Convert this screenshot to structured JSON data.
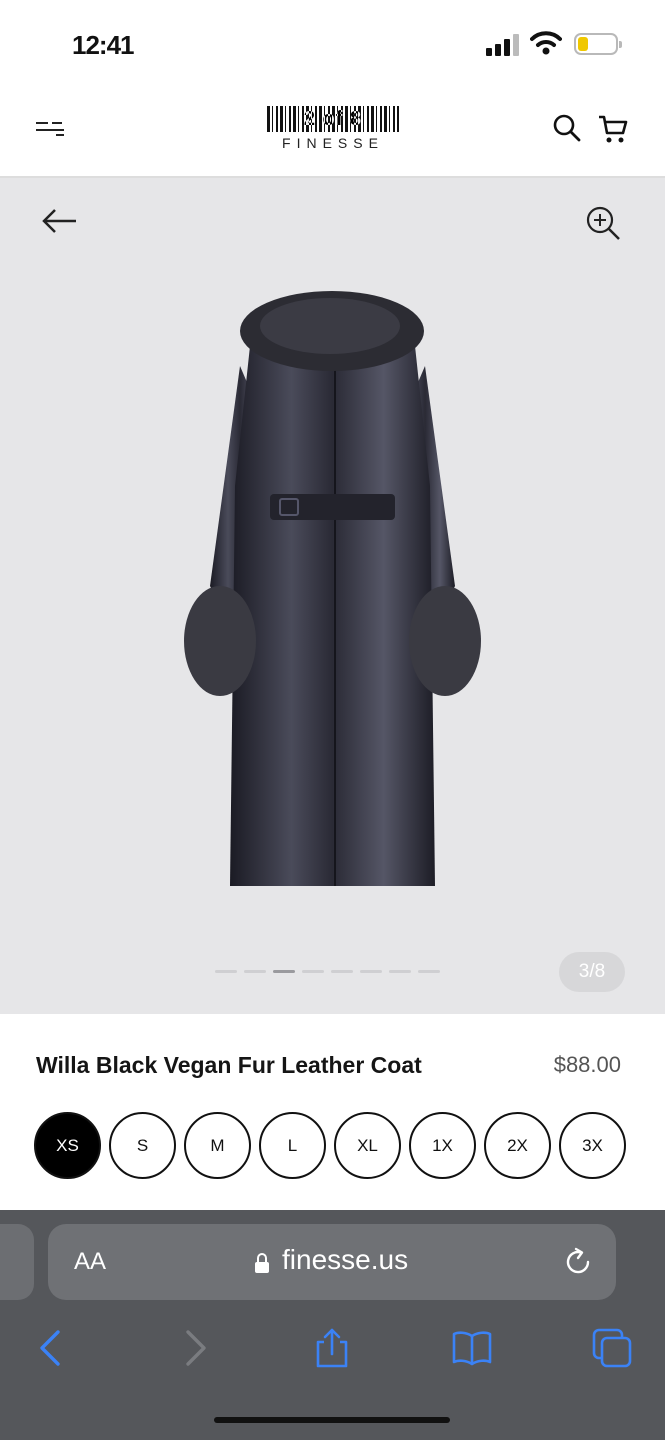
{
  "status_bar": {
    "time": "12:41"
  },
  "header": {
    "logo_text": "2 of 8",
    "brand": "FINESSE"
  },
  "gallery": {
    "counter": "3/8",
    "image_count": 8,
    "active_index": 2
  },
  "product": {
    "title": "Willa Black Vegan Fur Leather Coat",
    "price": "$88.00",
    "sizes": [
      "XS",
      "S",
      "M",
      "L",
      "XL",
      "1X",
      "2X",
      "3X"
    ],
    "selected_size": "XS"
  },
  "browser": {
    "aa_label": "AA",
    "url": "finesse.us"
  },
  "colors": {
    "gallery_bg": "#e6e6e8",
    "safari_bg": "#55575b",
    "accent_blue": "#3b82f6",
    "battery": "#f0c800"
  },
  "icons": [
    "menu-icon",
    "search-icon",
    "cart-icon",
    "back-arrow-icon",
    "zoom-in-icon",
    "lock-icon",
    "reload-icon",
    "browser-back-icon",
    "browser-forward-icon",
    "share-icon",
    "bookmarks-icon",
    "tabs-icon"
  ]
}
